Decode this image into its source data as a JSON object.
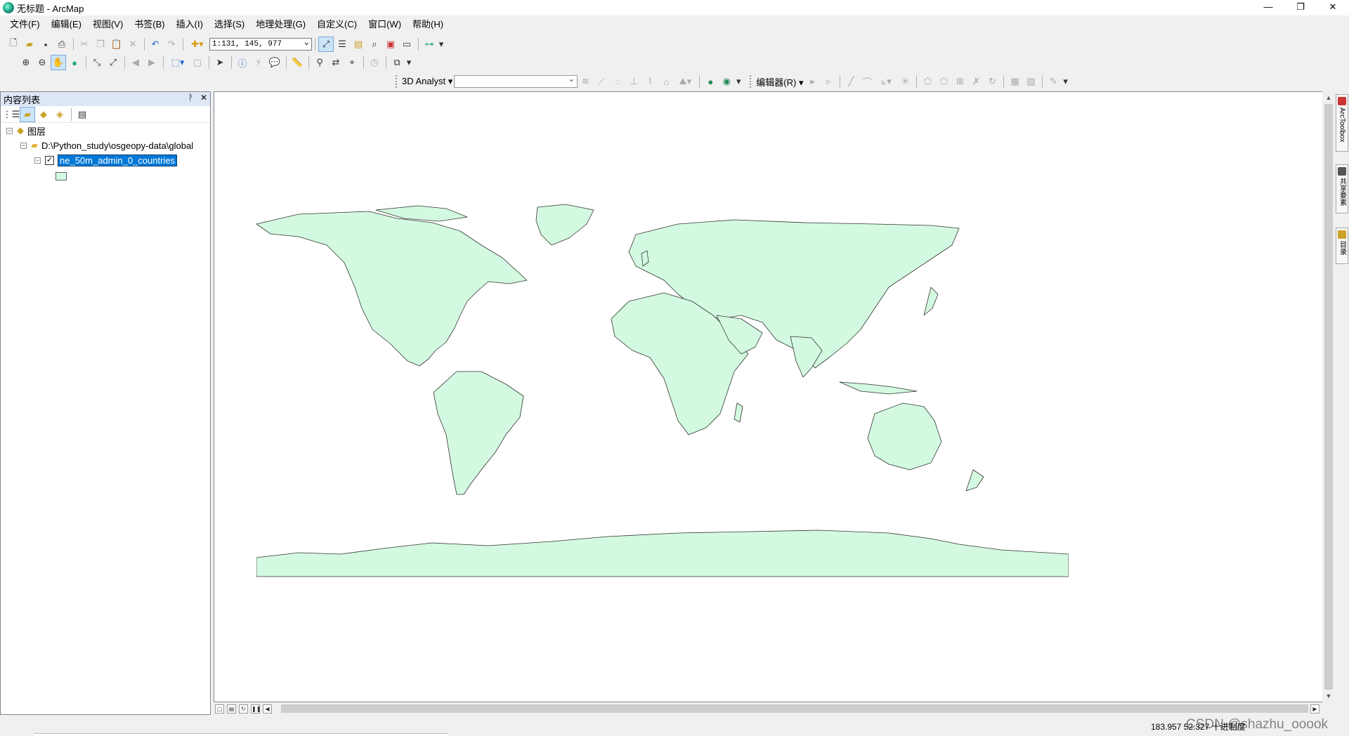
{
  "window": {
    "title": "无标题 - ArcMap",
    "minimize": "—",
    "restore": "❐",
    "close": "✕"
  },
  "menu": [
    "文件(F)",
    "编辑(E)",
    "视图(V)",
    "书签(B)",
    "插入(I)",
    "选择(S)",
    "地理处理(G)",
    "自定义(C)",
    "窗口(W)",
    "帮助(H)"
  ],
  "toolbar_standard": {
    "scale": "1:131, 145, 977"
  },
  "toolbar_3d": {
    "label": "3D Analyst ▾",
    "layer_value": ""
  },
  "toolbar_editor": {
    "label": "编辑器(R) ▾"
  },
  "toc": {
    "title": "内容列表",
    "pin": "ᚹ",
    "close": "✕",
    "tree": {
      "root": "图层",
      "folder": "D:\\Python_study\\osgeopy-data\\global",
      "layer": "ne_50m_admin_0_countries",
      "layer_checked": true
    }
  },
  "map": {
    "fill_color": "#d3fae0",
    "stroke_color": "#333333"
  },
  "right_dock": [
    "ArcToolbox",
    "共享要素",
    "目录"
  ],
  "status": {
    "coords": "183.957   52.327 十进制度",
    "watermark": "CSDN @shazhu_ooook"
  }
}
